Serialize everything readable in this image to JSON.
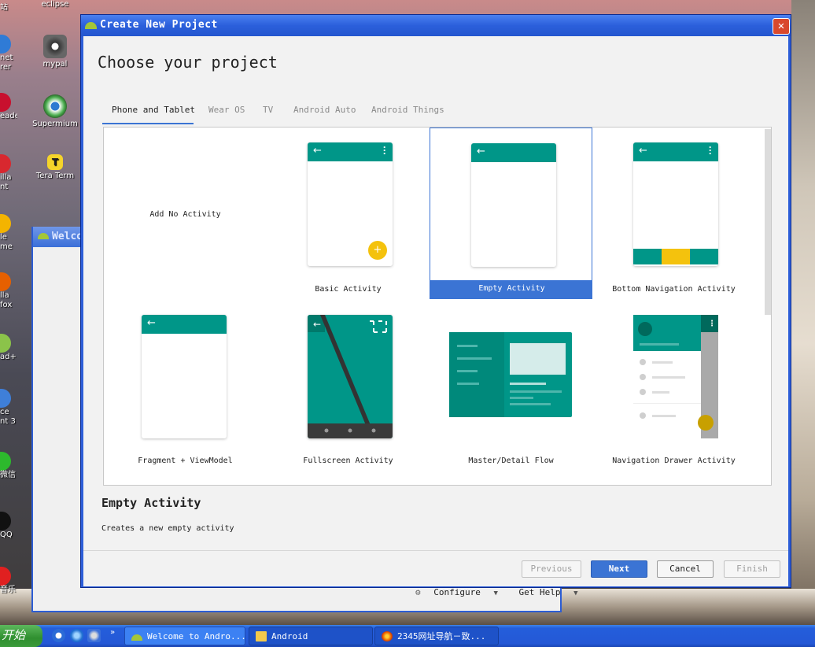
{
  "desktop": {
    "icons": [
      {
        "label": "eclipse"
      },
      {
        "label": "mypal"
      },
      {
        "label": "Supermium"
      },
      {
        "label": "Tera Term"
      }
    ],
    "left_labels": [
      "站",
      "net",
      "rer",
      "eader",
      "illa",
      "nt",
      "le",
      "me",
      "lla",
      "fox",
      "ad++",
      "ce",
      "nt 3",
      "微信",
      "QQ",
      "音乐"
    ]
  },
  "welcome_window": {
    "title": "Welco",
    "configure_label": "Configure",
    "get_help_label": "Get Help"
  },
  "dialog": {
    "title": "Create New Project",
    "close_symbol": "✕",
    "headline": "Choose your project",
    "tabs": [
      "Phone and Tablet",
      "Wear OS",
      "TV",
      "Android Auto",
      "Android Things"
    ],
    "active_tab": "Phone and Tablet",
    "templates": [
      {
        "label": "Add No Activity"
      },
      {
        "label": "Basic Activity"
      },
      {
        "label": "Empty Activity",
        "selected": true
      },
      {
        "label": "Bottom Navigation Activity"
      },
      {
        "label": "Fragment + ViewModel"
      },
      {
        "label": "Fullscreen Activity"
      },
      {
        "label": "Master/Detail Flow"
      },
      {
        "label": "Navigation Drawer Activity"
      }
    ],
    "description_title": "Empty Activity",
    "description_text": "Creates a new empty activity",
    "buttons": {
      "previous": "Previous",
      "next": "Next",
      "cancel": "Cancel",
      "finish": "Finish"
    },
    "colors": {
      "accent": "#3b74d4",
      "teal": "#009688",
      "fab": "#f4c20d"
    }
  },
  "taskbar": {
    "start_label": "开始",
    "items": [
      {
        "label": "Welcome to Andro..."
      },
      {
        "label": "Android"
      },
      {
        "label": "2345网址导航－致..."
      }
    ]
  }
}
